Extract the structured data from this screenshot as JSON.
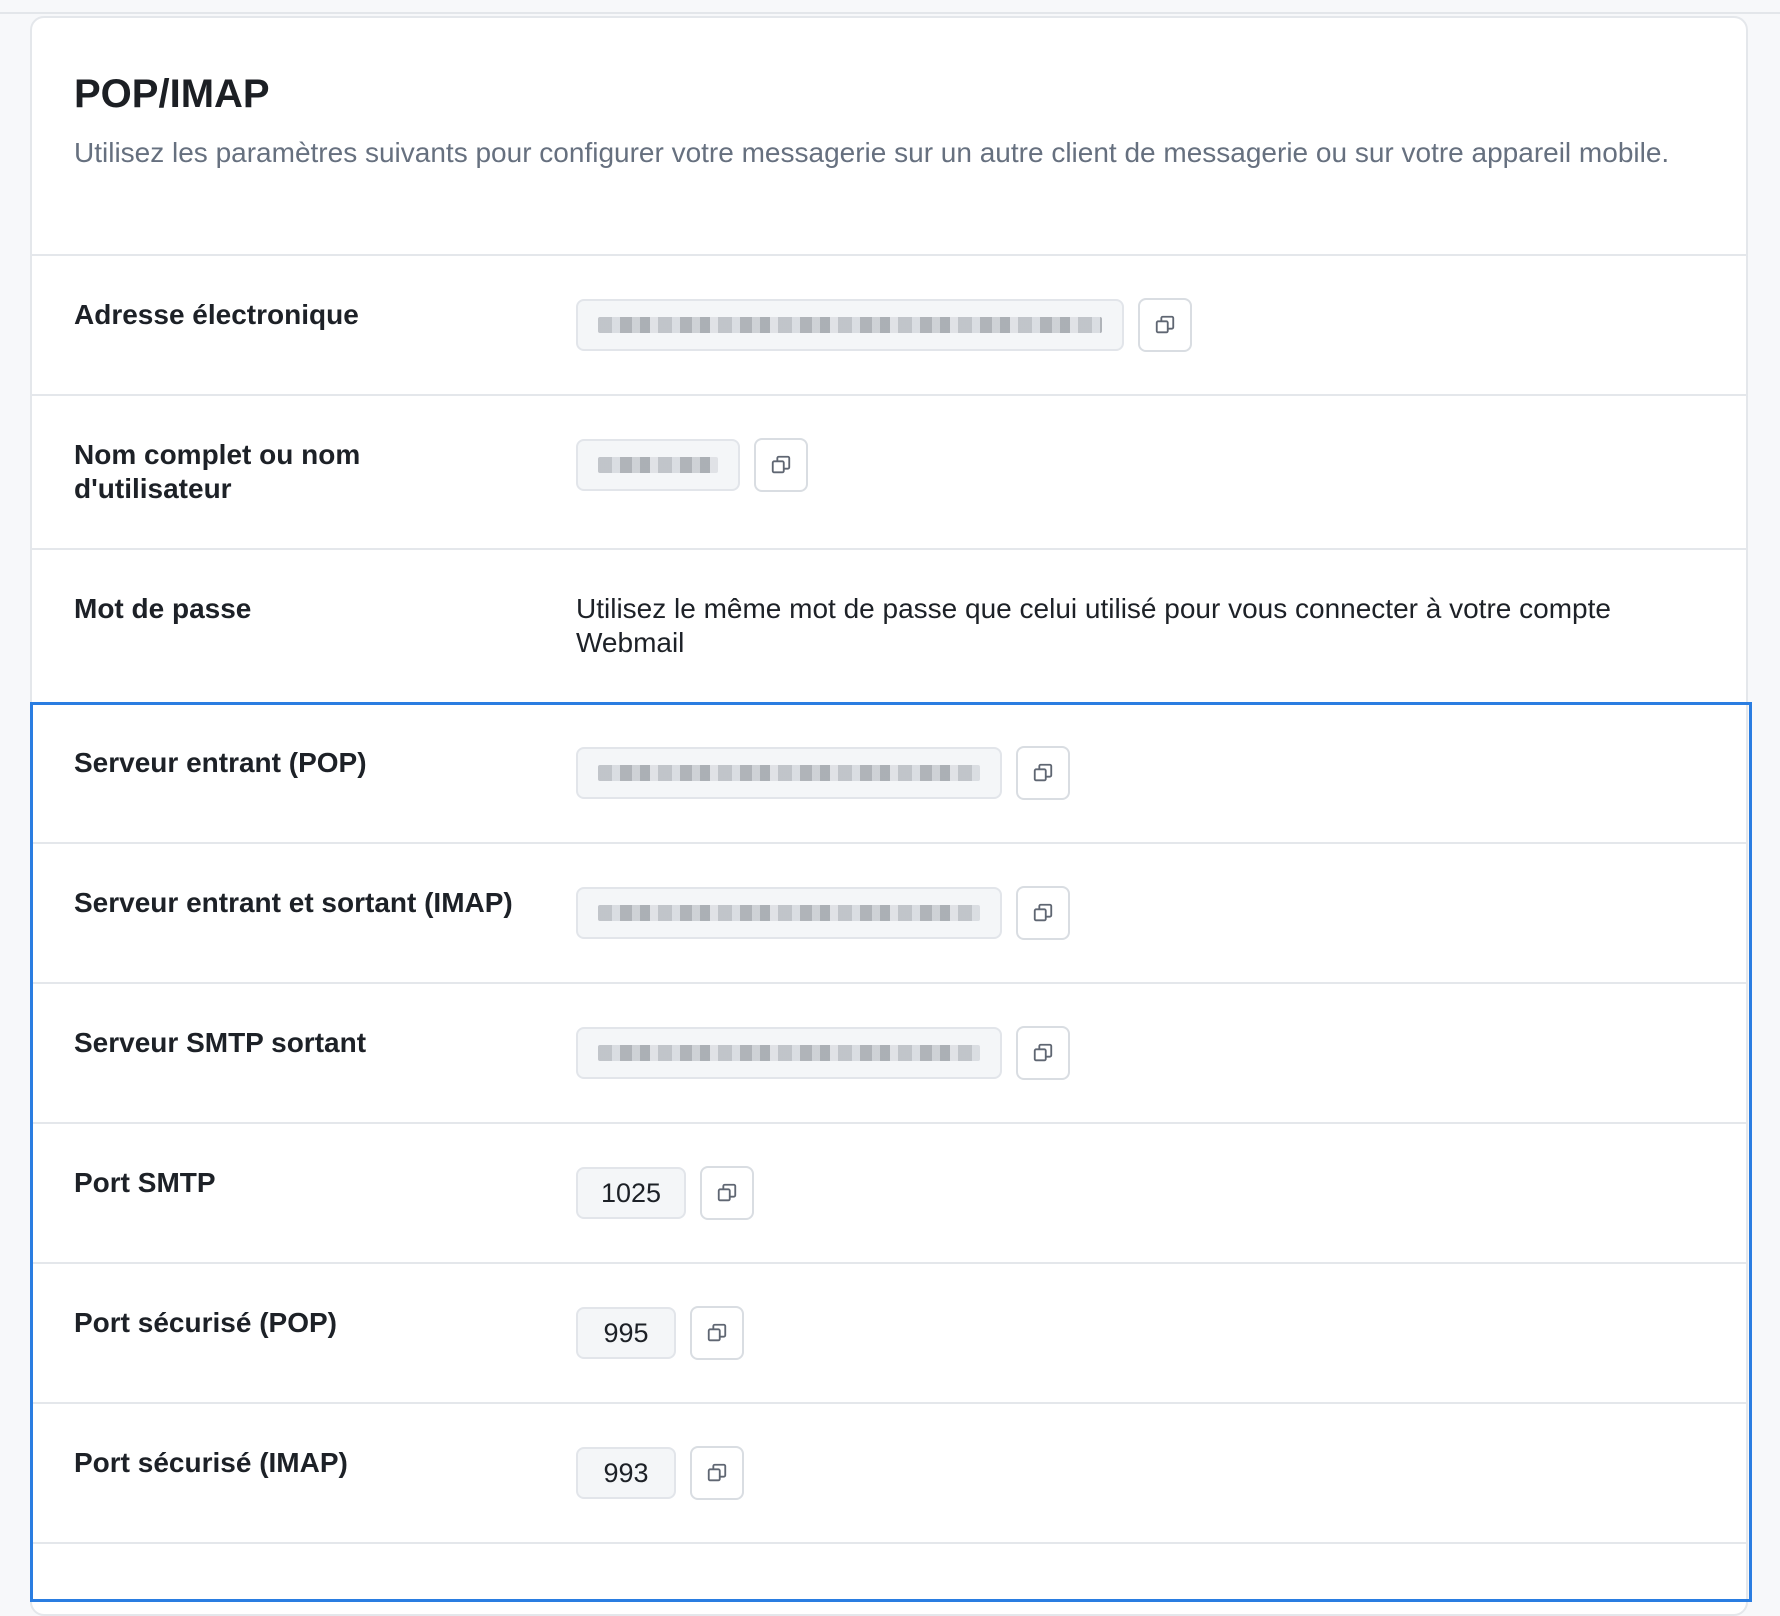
{
  "section": {
    "title": "POP/IMAP",
    "subtitle": "Utilisez les paramètres suivants pour configurer votre messagerie sur un autre client de messagerie ou sur votre appareil mobile."
  },
  "rows": {
    "email": {
      "label": "Adresse électronique"
    },
    "username": {
      "label": "Nom complet ou nom d'utilisateur"
    },
    "password": {
      "label": "Mot de passe",
      "text": "Utilisez le même mot de passe que celui utilisé pour vous connecter à votre compte Webmail"
    },
    "pop_server": {
      "label": "Serveur entrant (POP)"
    },
    "imap_server": {
      "label": "Serveur entrant et sortant (IMAP)"
    },
    "smtp_server": {
      "label": "Serveur SMTP sortant"
    },
    "smtp_port": {
      "label": "Port SMTP",
      "value": "1025"
    },
    "pop_secure_port": {
      "label": "Port sécurisé (POP)",
      "value": "995"
    },
    "imap_secure_port": {
      "label": "Port sécurisé (IMAP)",
      "value": "993"
    }
  },
  "icons": {
    "copy": "copy-icon"
  },
  "colors": {
    "highlight": "#2a7de1",
    "subtitle": "#66707f"
  }
}
